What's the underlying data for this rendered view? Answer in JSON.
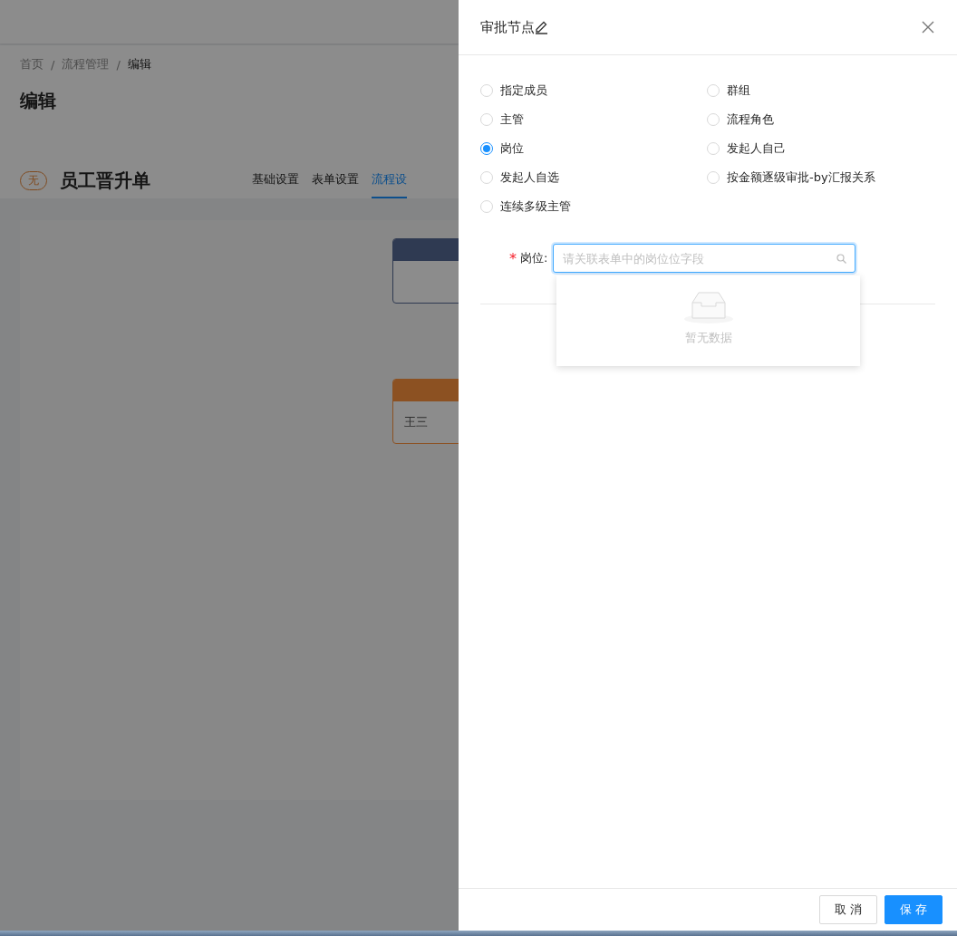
{
  "page": {
    "breadcrumb": [
      {
        "label": "首页",
        "current": false
      },
      {
        "label": "流程管理",
        "current": false
      },
      {
        "label": "编辑",
        "current": true
      }
    ],
    "breadcrumb_separators": [
      "/",
      "/"
    ],
    "title": "编辑",
    "form": {
      "badge": "无",
      "name": "员工晋升单"
    },
    "tabs": [
      {
        "label": "基础设置",
        "selected": false
      },
      {
        "label": "表单设置",
        "selected": false
      },
      {
        "label": "流程设",
        "selected": true
      }
    ],
    "nodes": [
      {
        "kind": "start"
      },
      {
        "kind": "approver",
        "text": "王三"
      }
    ]
  },
  "drawer": {
    "title": "审批节点",
    "options": [
      {
        "label": "指定成员",
        "selected": false
      },
      {
        "label": "群组",
        "selected": false
      },
      {
        "label": "主管",
        "selected": false
      },
      {
        "label": "流程角色",
        "selected": false
      },
      {
        "label": "岗位",
        "selected": true
      },
      {
        "label": "发起人自己",
        "selected": false
      },
      {
        "label": "发起人自选",
        "selected": false
      },
      {
        "label": "按金额逐级审批-by汇报关系",
        "selected": false
      },
      {
        "label": "连续多级主管",
        "selected": false
      }
    ],
    "field": {
      "label": "岗位:",
      "required_mark": "*",
      "placeholder": "请关联表单中的岗位位字段"
    },
    "dropdown": {
      "empty_text": "暂无数据"
    },
    "buttons": [
      {
        "label": "取 消",
        "kind": "default"
      },
      {
        "label": "保 存",
        "kind": "primary"
      }
    ]
  }
}
